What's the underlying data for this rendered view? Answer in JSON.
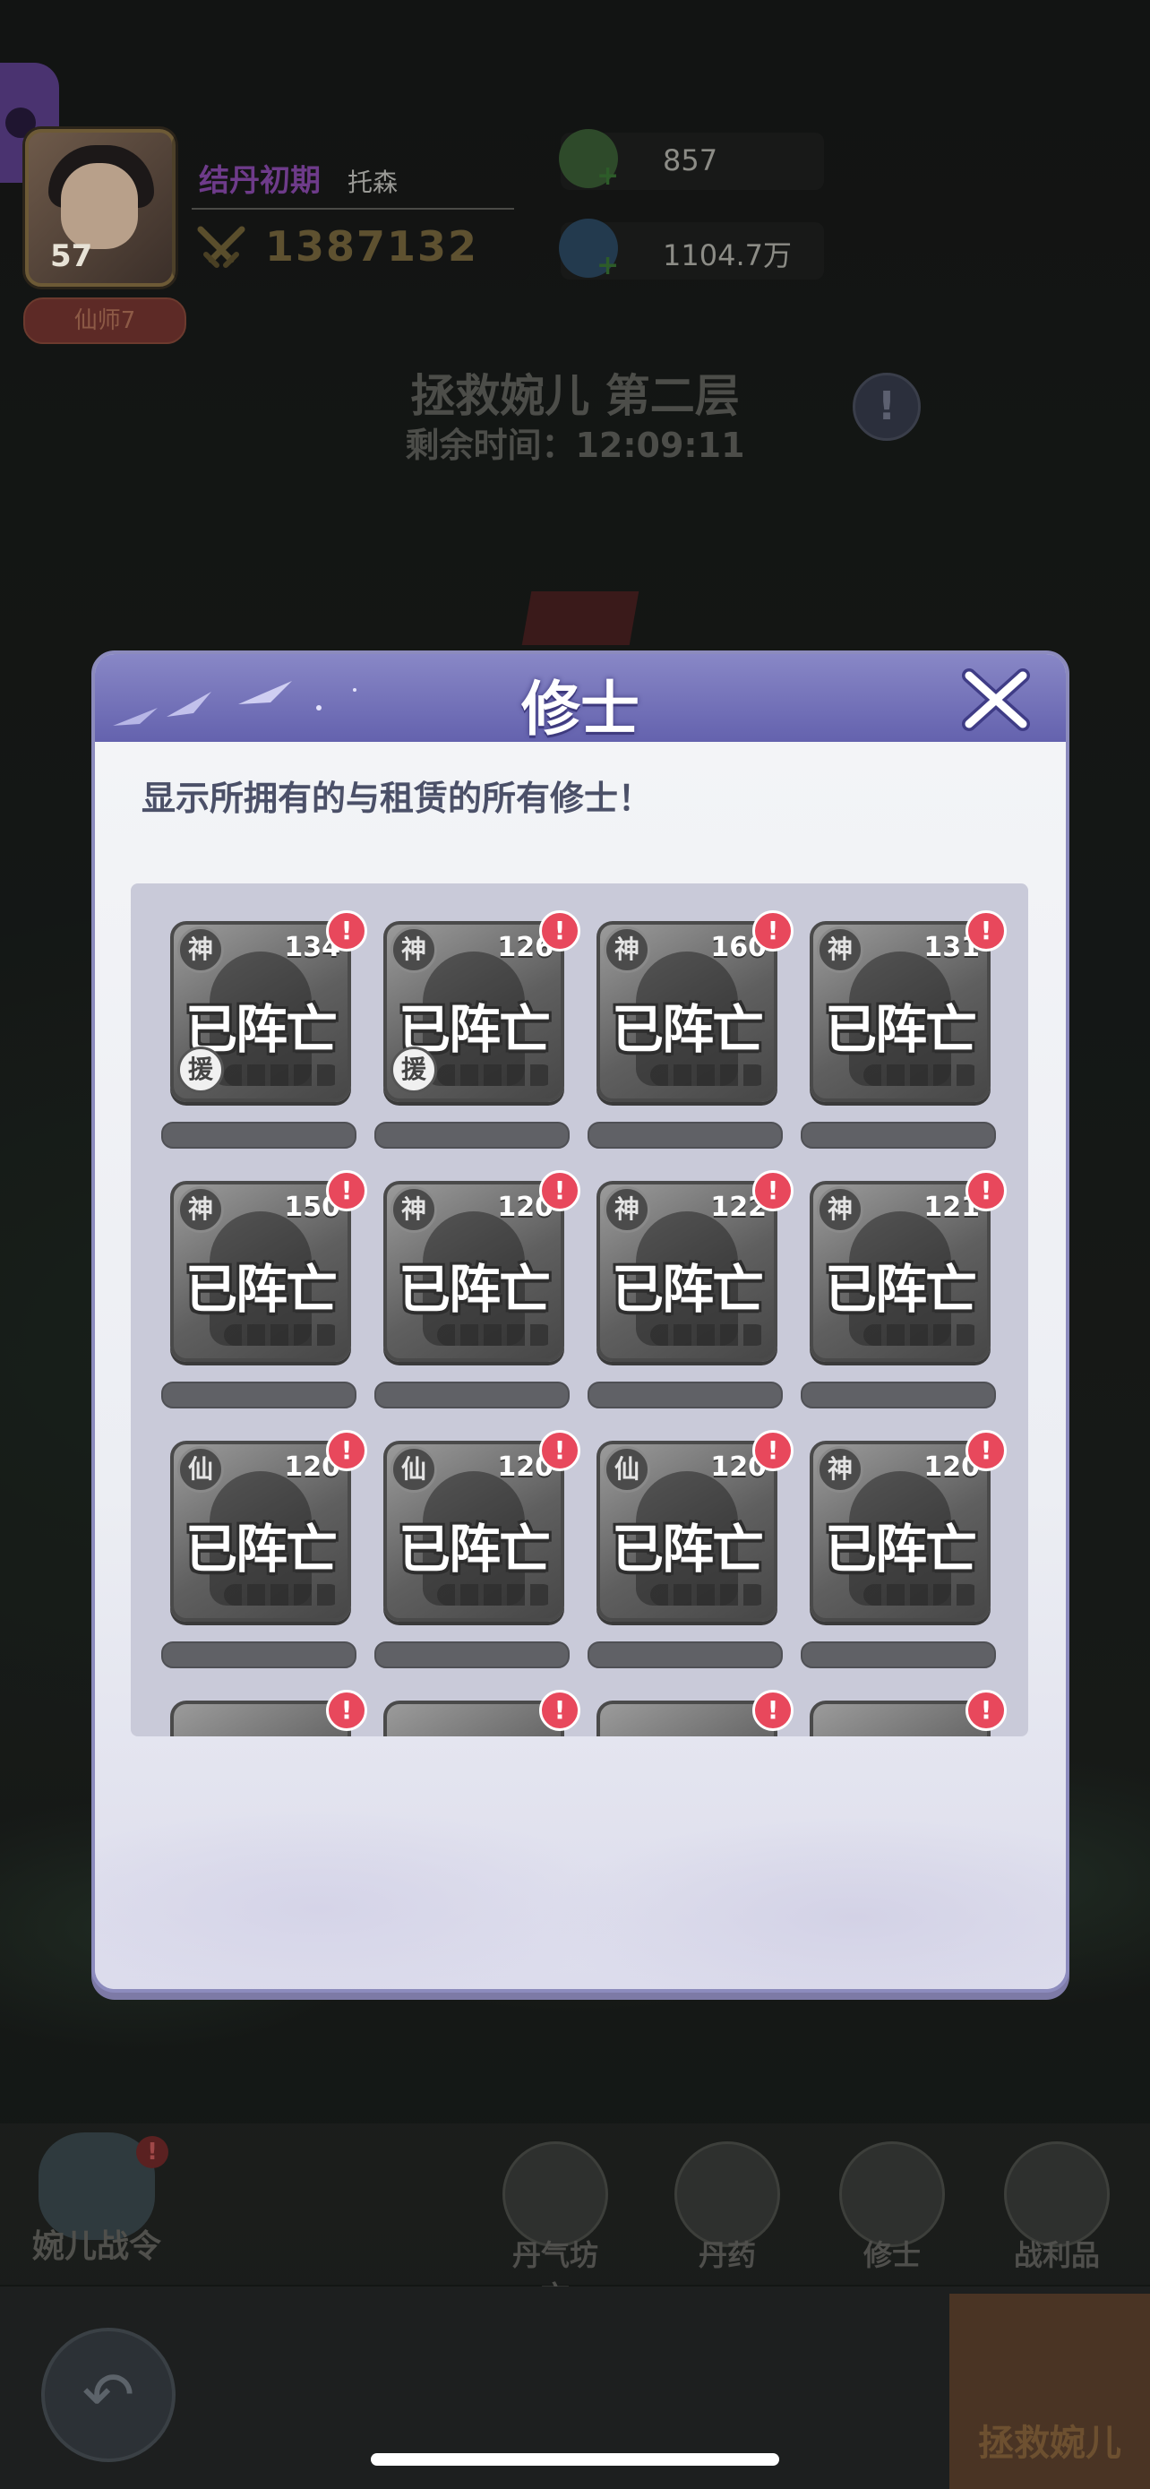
{
  "player": {
    "level": "57",
    "realm": "结丹初期",
    "name": "托森",
    "power": "1387132",
    "title": "仙师7"
  },
  "resources": [
    {
      "icon": "jade-plus-icon",
      "value": "857"
    },
    {
      "icon": "spirit-stone-plus-icon",
      "value": "1104.7万"
    }
  ],
  "stage": {
    "title": "拯救婉儿 第二层",
    "timer": "剩余时间：12:09:11"
  },
  "help_icon": "!",
  "modal": {
    "title": "修士",
    "subtitle": "显示所拥有的与租赁的所有修士！",
    "dead_label": "已阵亡",
    "alert": "!",
    "cards": [
      {
        "tier": "神",
        "level": "134",
        "aid": "援"
      },
      {
        "tier": "神",
        "level": "126",
        "aid": "援"
      },
      {
        "tier": "神",
        "level": "160",
        "aid": ""
      },
      {
        "tier": "神",
        "level": "131",
        "aid": ""
      },
      {
        "tier": "神",
        "level": "150",
        "aid": ""
      },
      {
        "tier": "神",
        "level": "120",
        "aid": ""
      },
      {
        "tier": "神",
        "level": "122",
        "aid": ""
      },
      {
        "tier": "神",
        "level": "121",
        "aid": ""
      },
      {
        "tier": "仙",
        "level": "120",
        "aid": ""
      },
      {
        "tier": "仙",
        "level": "120",
        "aid": ""
      },
      {
        "tier": "仙",
        "level": "120",
        "aid": ""
      },
      {
        "tier": "神",
        "level": "120",
        "aid": ""
      }
    ]
  },
  "bottom_nav": {
    "lingpass": "婉儿战令",
    "lingpass_badge": "!",
    "items": [
      "丹气坊市",
      "丹药",
      "修士",
      "战利品"
    ],
    "rescue": "拯救婉儿"
  },
  "colors": {
    "modal_header": "#6f6db6",
    "alert_red": "#e8485c",
    "dead_card_gray": "#5f5f5f"
  }
}
